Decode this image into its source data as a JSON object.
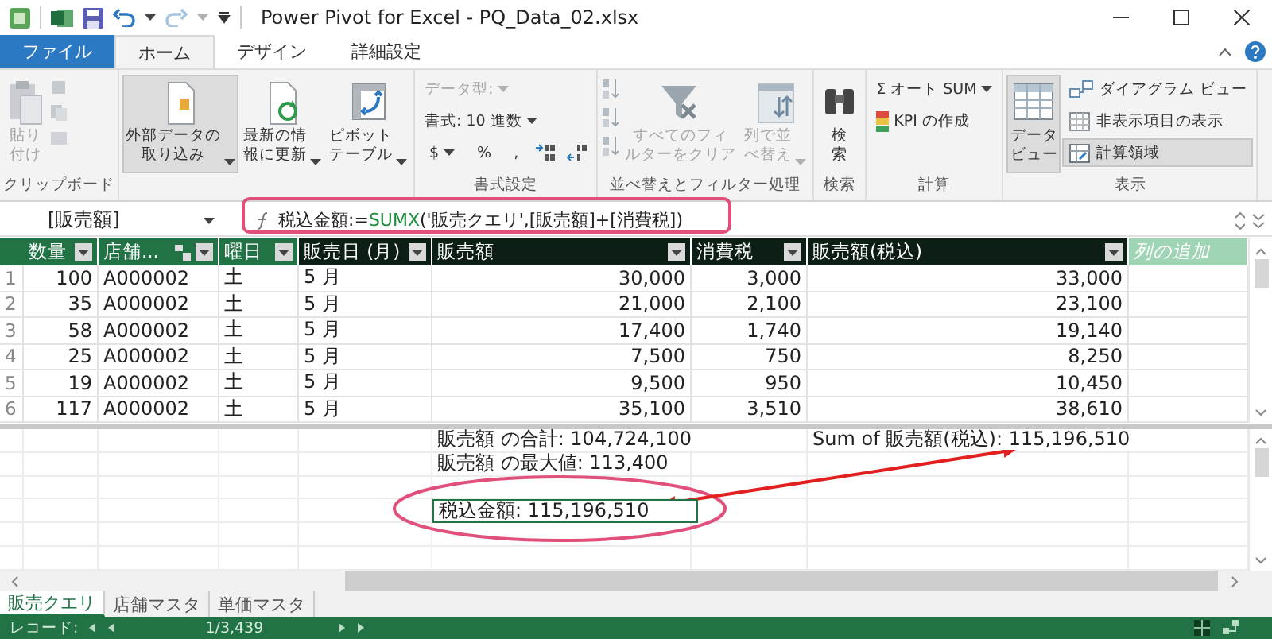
{
  "window": {
    "title": "Power Pivot for Excel - PQ_Data_02.xlsx"
  },
  "tabs": [
    {
      "label": "ファイル",
      "kind": "file",
      "selected": false
    },
    {
      "label": "ホーム",
      "kind": "tab",
      "selected": true
    },
    {
      "label": "デザイン",
      "kind": "tab",
      "selected": false
    },
    {
      "label": "詳細設定",
      "kind": "tab",
      "selected": false
    }
  ],
  "ribbon": {
    "groups": [
      {
        "label": "クリップボード",
        "items": [
          {
            "kind": "large",
            "lines": [
              "貼り",
              "付け"
            ],
            "disabled": true,
            "menu": false,
            "selected": false
          },
          {
            "kind": "icon-stack"
          }
        ]
      },
      {
        "items": [
          {
            "kind": "large",
            "lines": [
              "外部データの",
              "取り込み"
            ],
            "disabled": false,
            "menu": true,
            "selected": true
          },
          {
            "kind": "large",
            "lines": [
              "最新の情",
              "報に更新"
            ],
            "disabled": false,
            "menu": true,
            "selected": false
          },
          {
            "kind": "large",
            "lines": [
              "ピボット",
              "テーブル"
            ],
            "disabled": false,
            "menu": true,
            "selected": false
          }
        ]
      },
      {
        "label": "書式設定",
        "items": [
          {
            "kind": "dropdown",
            "label": "データ型:",
            "disabled": true,
            "menu": true
          },
          {
            "kind": "dropdown",
            "label": "書式: 10 進数",
            "disabled": false,
            "menu": true
          },
          {
            "kind": "format-row",
            "symbols": [
              "$",
              "%",
              ","
            ]
          }
        ]
      },
      {
        "label": "並べ替えとフィルター処理",
        "items": [
          {
            "kind": "sort-stack"
          },
          {
            "kind": "large",
            "lines": [
              "すべてのフィ",
              "ルターをクリア"
            ],
            "disabled": true,
            "menu": false,
            "selected": false
          },
          {
            "kind": "large",
            "lines": [
              "列で並",
              "べ替え"
            ],
            "disabled": true,
            "menu": true,
            "selected": false
          }
        ]
      },
      {
        "label": "検索",
        "items": [
          {
            "kind": "large",
            "lines": [
              "検",
              "索"
            ],
            "disabled": false,
            "menu": false,
            "selected": false
          }
        ]
      },
      {
        "label": "計算",
        "items": [
          {
            "kind": "small",
            "symbol": "Σ",
            "label": "オート SUM",
            "disabled": false,
            "menu": true,
            "selected": false
          },
          {
            "kind": "small",
            "label": "KPI の作成",
            "disabled": false,
            "menu": false,
            "selected": false
          }
        ]
      },
      {
        "label": "表示",
        "items": [
          {
            "kind": "large",
            "lines": [
              "データ",
              "ビュー"
            ],
            "disabled": false,
            "menu": false,
            "selected": true
          },
          {
            "kind": "small",
            "label": "ダイアグラム ビュー",
            "disabled": false,
            "menu": false,
            "selected": false
          },
          {
            "kind": "small",
            "label": "非表示項目の表示",
            "disabled": false,
            "menu": false,
            "selected": false
          },
          {
            "kind": "small",
            "label": "計算領域",
            "disabled": false,
            "menu": false,
            "selected": true
          }
        ]
      }
    ]
  },
  "formula_bar": {
    "name_box": "[販売額]",
    "formula": [
      {
        "text": "税込金額:=",
        "kind": "plain"
      },
      {
        "text": "SUMX",
        "kind": "function"
      },
      {
        "text": "('販売クエリ',[販売額]+[消費税])",
        "kind": "plain"
      }
    ]
  },
  "table": {
    "columns": [
      {
        "label": "数量",
        "kind": "imported",
        "numeric": true,
        "related": false
      },
      {
        "label": "店舗...",
        "kind": "imported",
        "numeric": false,
        "related": true
      },
      {
        "label": "曜日",
        "kind": "imported",
        "numeric": false,
        "related": false
      },
      {
        "label": "販売日 (月)",
        "kind": "calculated",
        "numeric": false,
        "related": false
      },
      {
        "label": "販売額",
        "kind": "calculated",
        "numeric": true,
        "related": false
      },
      {
        "label": "消費税",
        "kind": "calculated",
        "numeric": true,
        "related": false
      },
      {
        "label": "販売額(税込)",
        "kind": "calculated",
        "numeric": true,
        "related": false
      },
      {
        "label": "列の追加",
        "kind": "add",
        "related": false
      }
    ],
    "rows": [
      {
        "number": "1",
        "cells": [
          "100",
          "A000002",
          "土",
          "5 月",
          "30,000",
          "3,000",
          "33,000"
        ]
      },
      {
        "number": "2",
        "cells": [
          "35",
          "A000002",
          "土",
          "5 月",
          "21,000",
          "2,100",
          "23,100"
        ]
      },
      {
        "number": "3",
        "cells": [
          "58",
          "A000002",
          "土",
          "5 月",
          "17,400",
          "1,740",
          "19,140"
        ]
      },
      {
        "number": "4",
        "cells": [
          "25",
          "A000002",
          "土",
          "5 月",
          "7,500",
          "750",
          "8,250"
        ]
      },
      {
        "number": "5",
        "cells": [
          "19",
          "A000002",
          "土",
          "5 月",
          "9,500",
          "950",
          "10,450"
        ]
      },
      {
        "number": "6",
        "cells": [
          "117",
          "A000002",
          "土",
          "5 月",
          "35,100",
          "3,510",
          "38,610"
        ]
      }
    ]
  },
  "calc_area": {
    "rows": [
      [
        null,
        null,
        null,
        null,
        {
          "text": "販売額 の合計: 104,724,100",
          "selected": false
        },
        null,
        {
          "text": "Sum of 販売額(税込): 115,196,510",
          "selected": false
        },
        null
      ],
      [
        null,
        null,
        null,
        null,
        {
          "text": "販売額 の最大値: 113,400",
          "selected": false
        },
        null,
        null,
        null
      ],
      [
        null,
        null,
        null,
        null,
        null,
        null,
        null,
        null
      ],
      [
        null,
        null,
        null,
        null,
        {
          "text": "税込金額: 115,196,510",
          "selected": true
        },
        null,
        null,
        null
      ],
      [
        null,
        null,
        null,
        null,
        null,
        null,
        null,
        null
      ],
      [
        null,
        null,
        null,
        null,
        null,
        null,
        null,
        null
      ]
    ]
  },
  "sheet_tabs": [
    {
      "label": "販売クエリ",
      "selected": true
    },
    {
      "label": "店舗マスタ",
      "selected": false
    },
    {
      "label": "単価マスタ",
      "selected": false
    }
  ],
  "status_bar": {
    "record_label": "レコード:",
    "record_position": "1/3,439"
  }
}
